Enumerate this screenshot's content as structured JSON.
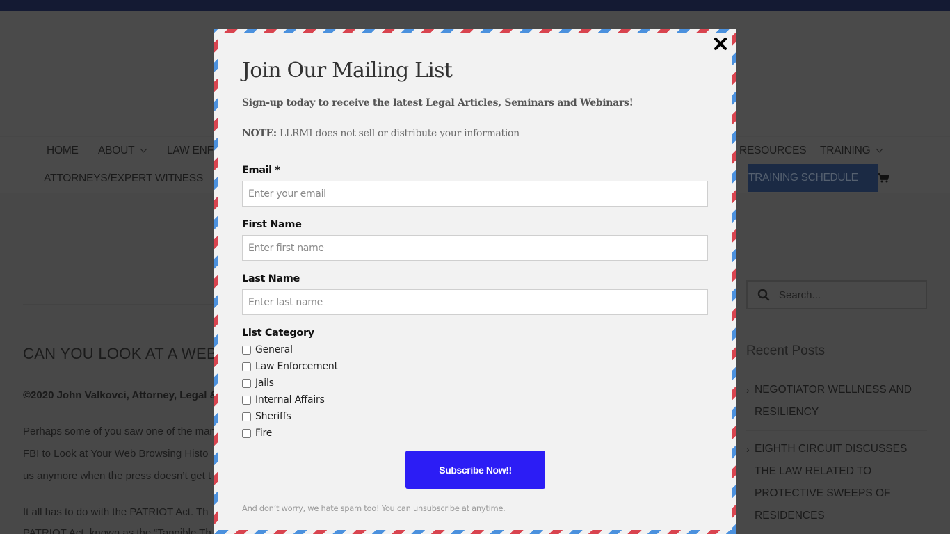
{
  "page": {
    "nav": {
      "row1": [
        "HOME",
        "ABOUT",
        "LAW ENF",
        "RESOURCES",
        "TRAINING"
      ],
      "row2_left": "ATTORNEYS/EXPERT WITNESS",
      "schedule_button": "TRAINING SCHEDULE"
    },
    "article": {
      "title": "CAN YOU LOOK AT A WEB",
      "byline": "©2020 John Valkovci, Attorney, Legal &",
      "paragraph1_lines": [
        "Perhaps some of you saw one of the man",
        "FBI to Look at Your Web Browsing Histo",
        "us anymore when the press doesn’t get t"
      ],
      "paragraph2_lines": [
        "It all has to do with the PATRIOT Act.  Th",
        "PATRIOT Act, known as the “Tangible Th"
      ]
    },
    "sidebar": {
      "search_placeholder": "Search...",
      "recent_posts_title": "Recent Posts",
      "recent_posts": [
        {
          "lines": [
            "NEGOTIATOR WELLNESS AND",
            "RESILIENCY"
          ]
        },
        {
          "lines": [
            "EIGHTH CIRCUIT DISCUSSES",
            "THE LAW RELATED TO",
            "PROTECTIVE SWEEPS OF",
            "RESIDENCES"
          ]
        }
      ]
    }
  },
  "modal": {
    "title": "Join Our Mailing List",
    "subtitle": "Sign-up today to receive the latest Legal Articles, Seminars and Webinars!",
    "note_label": "NOTE:",
    "note_text": " LLRMI does not sell or distribute your information",
    "fields": {
      "email": {
        "label": "Email *",
        "placeholder": "Enter your email",
        "value": ""
      },
      "first_name": {
        "label": "First Name",
        "placeholder": "Enter first name",
        "value": ""
      },
      "last_name": {
        "label": "Last Name",
        "placeholder": "Enter last name",
        "value": ""
      }
    },
    "list_category_label": "List Category",
    "categories": [
      {
        "label": "General",
        "checked": false
      },
      {
        "label": "Law Enforcement",
        "checked": false
      },
      {
        "label": "Jails",
        "checked": false
      },
      {
        "label": "Internal Affairs",
        "checked": false
      },
      {
        "label": "Sheriffs",
        "checked": false
      },
      {
        "label": "Fire",
        "checked": false
      }
    ],
    "submit_label": "Subscribe Now!!",
    "disclaimer": "And don’t worry, we hate spam too! You can unsubscribe at anytime.",
    "colors": {
      "submit": "#2c1df5",
      "stripe_red": "#d9444f",
      "stripe_blue": "#4b91de"
    }
  }
}
